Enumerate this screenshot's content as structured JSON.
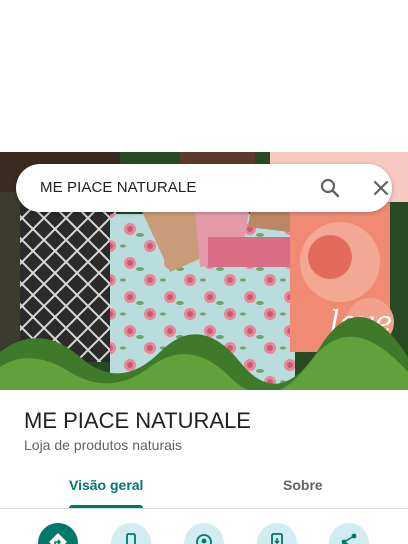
{
  "search": {
    "query": "ME PIACE NATURALE",
    "search_icon": "search-icon",
    "close_icon": "close-icon"
  },
  "place": {
    "name": "ME PIACE NATURALE",
    "category": "Loja de produtos naturais"
  },
  "tabs": [
    {
      "label": "Visão geral",
      "selected": true
    },
    {
      "label": "Sobre",
      "selected": false
    }
  ],
  "actions": [
    {
      "icon": "directions-icon"
    },
    {
      "icon": "phone-icon"
    },
    {
      "icon": "nearby-icon"
    },
    {
      "icon": "save-to-phone-icon"
    },
    {
      "icon": "share-icon"
    }
  ],
  "colors": {
    "accent": "#00796b",
    "action_bg": "#d3ebf2"
  }
}
